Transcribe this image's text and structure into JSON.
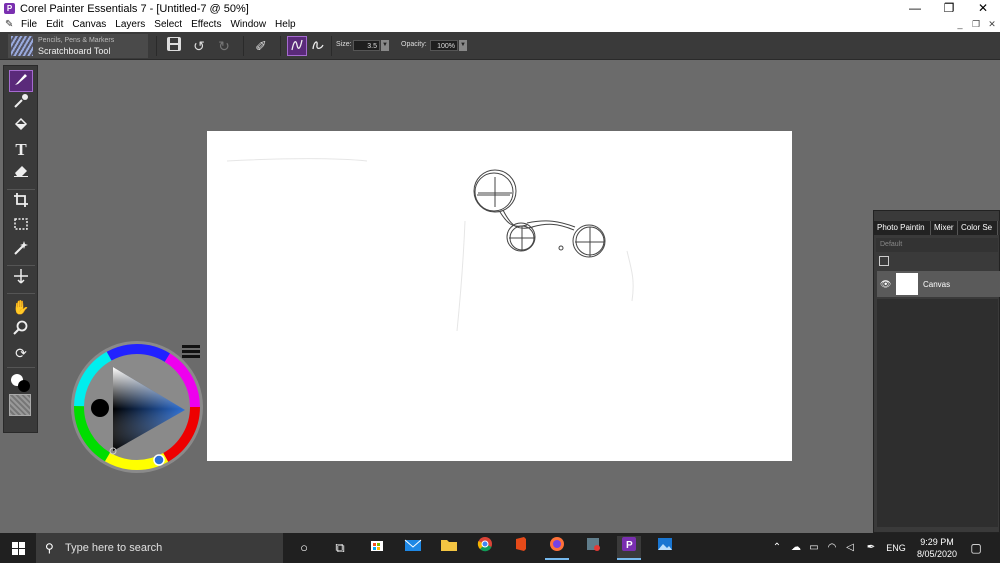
{
  "window": {
    "title": "Corel Painter Essentials 7 - [Untitled-7 @ 50%]",
    "controls": [
      "—",
      "❐",
      "✕"
    ]
  },
  "menu": [
    "File",
    "Edit",
    "Canvas",
    "Layers",
    "Select",
    "Effects",
    "Window",
    "Help"
  ],
  "propbar": {
    "brush_category": "Pencils, Pens & Markers",
    "brush_variant": "Scratchboard Tool",
    "size_label": "Size:",
    "size_value": "3.5",
    "opacity_label": "Opacity:",
    "opacity_value": "100%"
  },
  "toolbox": {
    "tools": [
      "brush-icon",
      "dropper-icon",
      "paint-bucket-icon",
      "text-icon",
      "eraser-icon",
      "crop-icon",
      "rect-select-icon",
      "magic-wand-icon",
      "transform-icon",
      "grabber-icon",
      "magnifier-icon",
      "rotate-icon"
    ],
    "active_tool": "brush-icon",
    "main_color": "#ffffff",
    "additional_color": "#000000"
  },
  "color_wheel": {
    "selected_color": "#000000"
  },
  "layers_panel": {
    "tabs": [
      "Photo Paintin",
      "Mixer",
      "Color Se"
    ],
    "library": "Default",
    "layers": [
      {
        "name": "Canvas",
        "visible": true
      }
    ]
  },
  "taskbar": {
    "search_placeholder": "Type here to search",
    "language": "ENG",
    "time": "9:29 PM",
    "date": "8/05/2020"
  },
  "colors": {
    "accent": "#7a2fb0",
    "workspace": "#6b6b6b",
    "panel": "#3a3a3a"
  }
}
